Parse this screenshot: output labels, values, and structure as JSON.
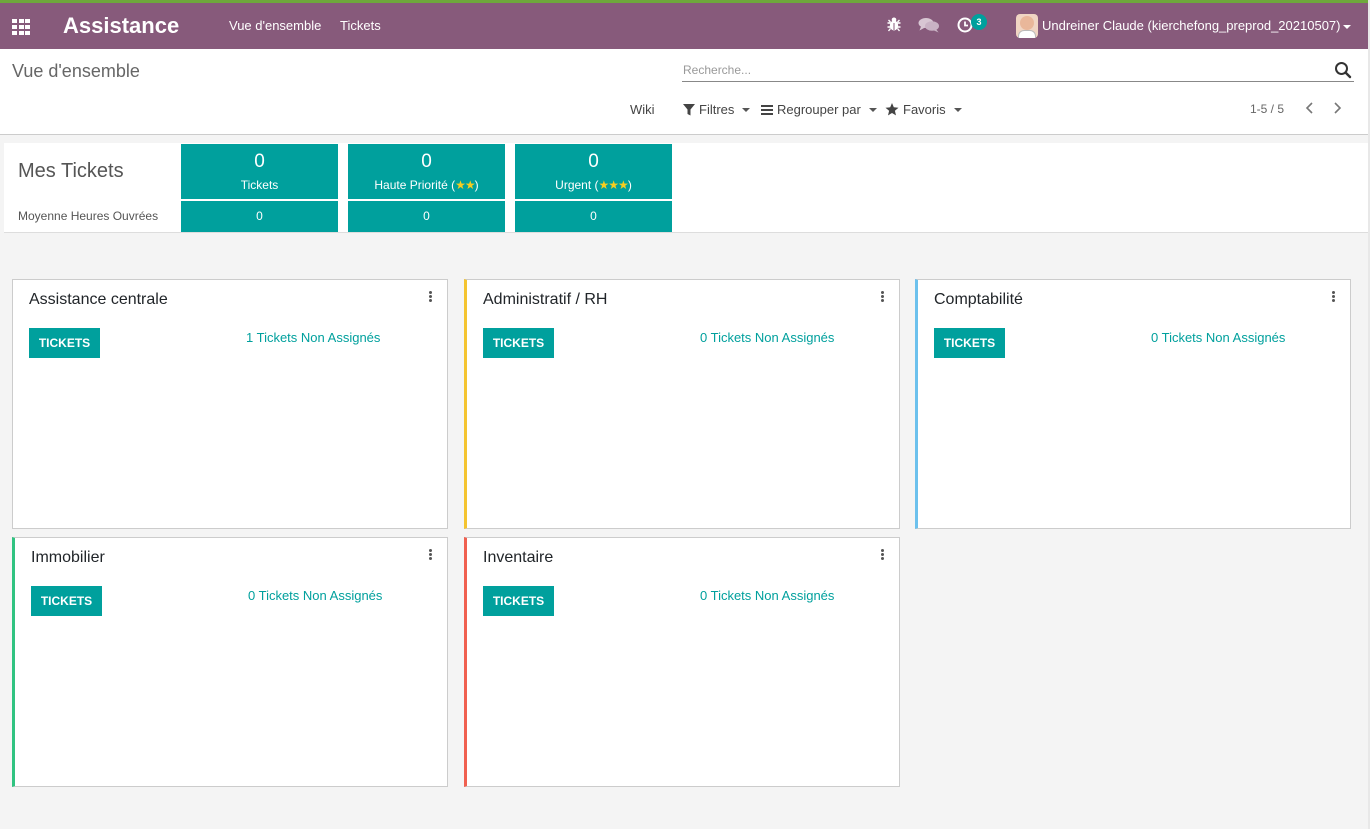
{
  "topbar": {
    "app_title": "Assistance",
    "menu": [
      "Vue d'ensemble",
      "Tickets"
    ],
    "activity_count": "3",
    "user_name": "Undreiner Claude (kierchefong_preprod_20210507)",
    "icons": [
      "apps-icon",
      "bug-icon",
      "chat-icon",
      "clock-icon",
      "user-avatar"
    ],
    "colors": {
      "brand": "#875a7b",
      "accent_top": "#6ea83c"
    }
  },
  "control_panel": {
    "breadcrumb": "Vue d'ensemble",
    "search_placeholder": "Recherche...",
    "wiki": "Wiki",
    "filters": "Filtres",
    "group_by": "Regrouper par",
    "favorites": "Favoris",
    "pager": "1-5 / 5"
  },
  "dashboard": {
    "title": "Mes Tickets",
    "subtitle": "Moyenne Heures Ouvrées",
    "kpis": [
      {
        "value": "0",
        "label": "Tickets",
        "stars": "",
        "avg": "0"
      },
      {
        "value": "0",
        "label": "Haute Priorité (",
        "stars": "★★",
        "label_end": ")",
        "avg": "0"
      },
      {
        "value": "0",
        "label": "Urgent (",
        "stars": "★★★",
        "label_end": ")",
        "avg": "0"
      }
    ],
    "kpi_color": "#00a09d"
  },
  "teams": [
    {
      "name": "Assistance centrale",
      "button": "TICKETS",
      "unassigned": "1 Tickets Non Assignés",
      "color": ""
    },
    {
      "name": "Administratif / RH",
      "button": "TICKETS",
      "unassigned": "0 Tickets Non Assignés",
      "color": "#f4c430"
    },
    {
      "name": "Comptabilité",
      "button": "TICKETS",
      "unassigned": "0 Tickets Non Assignés",
      "color": "#6cc1ed"
    },
    {
      "name": "Immobilier",
      "button": "TICKETS",
      "unassigned": "0 Tickets Non Assignés",
      "color": "#30c381"
    },
    {
      "name": "Inventaire",
      "button": "TICKETS",
      "unassigned": "0 Tickets Non Assignés",
      "color": "#f06050"
    }
  ]
}
